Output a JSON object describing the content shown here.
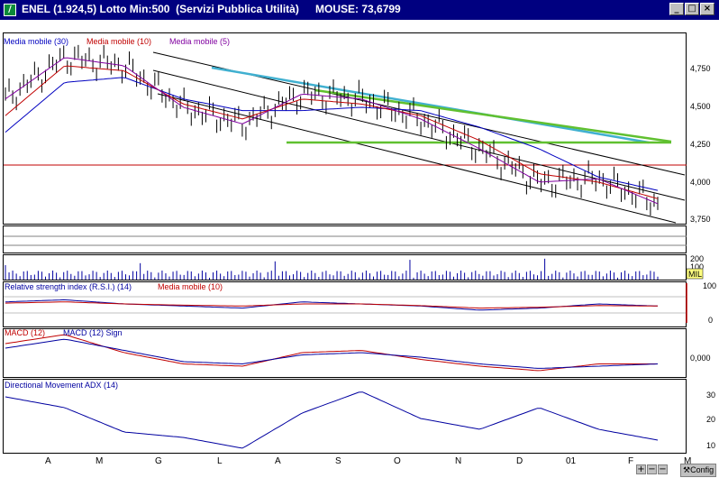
{
  "window": {
    "title": "ENEL (1.924,5) Lotto Min:500  (Servizi Pubblica Utilità)",
    "mouse_readout": "MOUSE: 73,6799",
    "minimize_label": "_",
    "maximize_label": "□",
    "close_label": "×",
    "app_icon_label": "/"
  },
  "legends": {
    "ma30": "Media mobile (30)",
    "ma10": "Media mobile (10)",
    "ma5": "Media mobile (5)",
    "rsi": "Relative strength index (R.S.I.) (14)",
    "rsi_ma": "Media mobile (10)",
    "macd": "MACD (12)",
    "macd_sign": "MACD (12) Sign",
    "adx": "Directional Movement ADX (14)"
  },
  "axis_labels": {
    "price": [
      "4,750",
      "4,500",
      "4,250",
      "4,000",
      "3,750"
    ],
    "volume": [
      "200",
      "100"
    ],
    "volume_unit": "MIL",
    "rsi": [
      "100",
      "0"
    ],
    "macd": [
      "0,000"
    ],
    "adx": [
      "30",
      "20",
      "10"
    ]
  },
  "months": [
    "A",
    "M",
    "G",
    "L",
    "A",
    "S",
    "O",
    "N",
    "D",
    "01",
    "F",
    "M"
  ],
  "controls": {
    "zoom_in": "+",
    "zoom_out": "−",
    "minus": "−",
    "config": "Config"
  },
  "colors": {
    "price_bars": "#000000",
    "ma30": "#0000c0",
    "ma10": "#c00000",
    "ma5": "#8000a0",
    "trend_cyan": "#40b0d0",
    "trend_green": "#60c030",
    "horizontal_red": "#c00000"
  },
  "chart_data": [
    {
      "type": "line",
      "title": "ENEL",
      "ylim": [
        3.7,
        4.85
      ],
      "y_ticks": [
        4.75,
        4.5,
        4.25,
        4.0,
        3.75
      ],
      "x": [
        "A",
        "M",
        "G",
        "L",
        "A",
        "S",
        "O",
        "N",
        "D",
        "01",
        "F",
        "M"
      ],
      "series": [
        {
          "name": "Media mobile (30)",
          "values": [
            4.25,
            4.55,
            4.58,
            4.45,
            4.38,
            4.38,
            4.4,
            4.38,
            4.28,
            4.15,
            3.98,
            3.9
          ]
        },
        {
          "name": "Media mobile (10)",
          "values": [
            4.35,
            4.65,
            4.62,
            4.42,
            4.33,
            4.45,
            4.42,
            4.35,
            4.2,
            4.0,
            3.95,
            3.85
          ]
        },
        {
          "name": "Media mobile (5)",
          "values": [
            4.45,
            4.7,
            4.65,
            4.4,
            4.3,
            4.48,
            4.45,
            4.33,
            4.15,
            3.95,
            3.97,
            3.82
          ]
        }
      ]
    },
    {
      "type": "line",
      "title": "Relative strength index (R.S.I.) (14)",
      "ylim": [
        0,
        100
      ],
      "x": [
        "A",
        "M",
        "G",
        "L",
        "A",
        "S",
        "O",
        "N",
        "D",
        "01",
        "F",
        "M"
      ],
      "series": [
        {
          "name": "Relative strength index (R.S.I.) (14)",
          "values": [
            55,
            60,
            50,
            45,
            40,
            55,
            50,
            45,
            35,
            40,
            50,
            45
          ]
        },
        {
          "name": "Media mobile (10)",
          "values": [
            52,
            55,
            50,
            47,
            45,
            50,
            50,
            46,
            40,
            42,
            46,
            45
          ]
        }
      ]
    },
    {
      "type": "line",
      "title": "MACD (12)",
      "x": [
        "A",
        "M",
        "G",
        "L",
        "A",
        "S",
        "O",
        "N",
        "D",
        "01",
        "F",
        "M"
      ],
      "series": [
        {
          "name": "MACD (12)",
          "values": [
            0.06,
            0.1,
            0.02,
            -0.03,
            -0.04,
            0.02,
            0.03,
            -0.01,
            -0.04,
            -0.06,
            -0.03,
            -0.03
          ]
        },
        {
          "name": "MACD (12) Sign",
          "values": [
            0.04,
            0.08,
            0.03,
            -0.02,
            -0.03,
            0.01,
            0.02,
            0.0,
            -0.03,
            -0.05,
            -0.04,
            -0.03
          ]
        }
      ]
    },
    {
      "type": "line",
      "title": "Directional Movement ADX (14)",
      "ylim": [
        8,
        34
      ],
      "y_ticks": [
        30,
        20,
        10
      ],
      "x": [
        "A",
        "M",
        "G",
        "L",
        "A",
        "S",
        "O",
        "N",
        "D",
        "01",
        "F",
        "M"
      ],
      "series": [
        {
          "name": "Directional Movement ADX (14)",
          "values": [
            28,
            24,
            15,
            13,
            9,
            22,
            30,
            20,
            16,
            24,
            16,
            12
          ]
        }
      ]
    }
  ]
}
